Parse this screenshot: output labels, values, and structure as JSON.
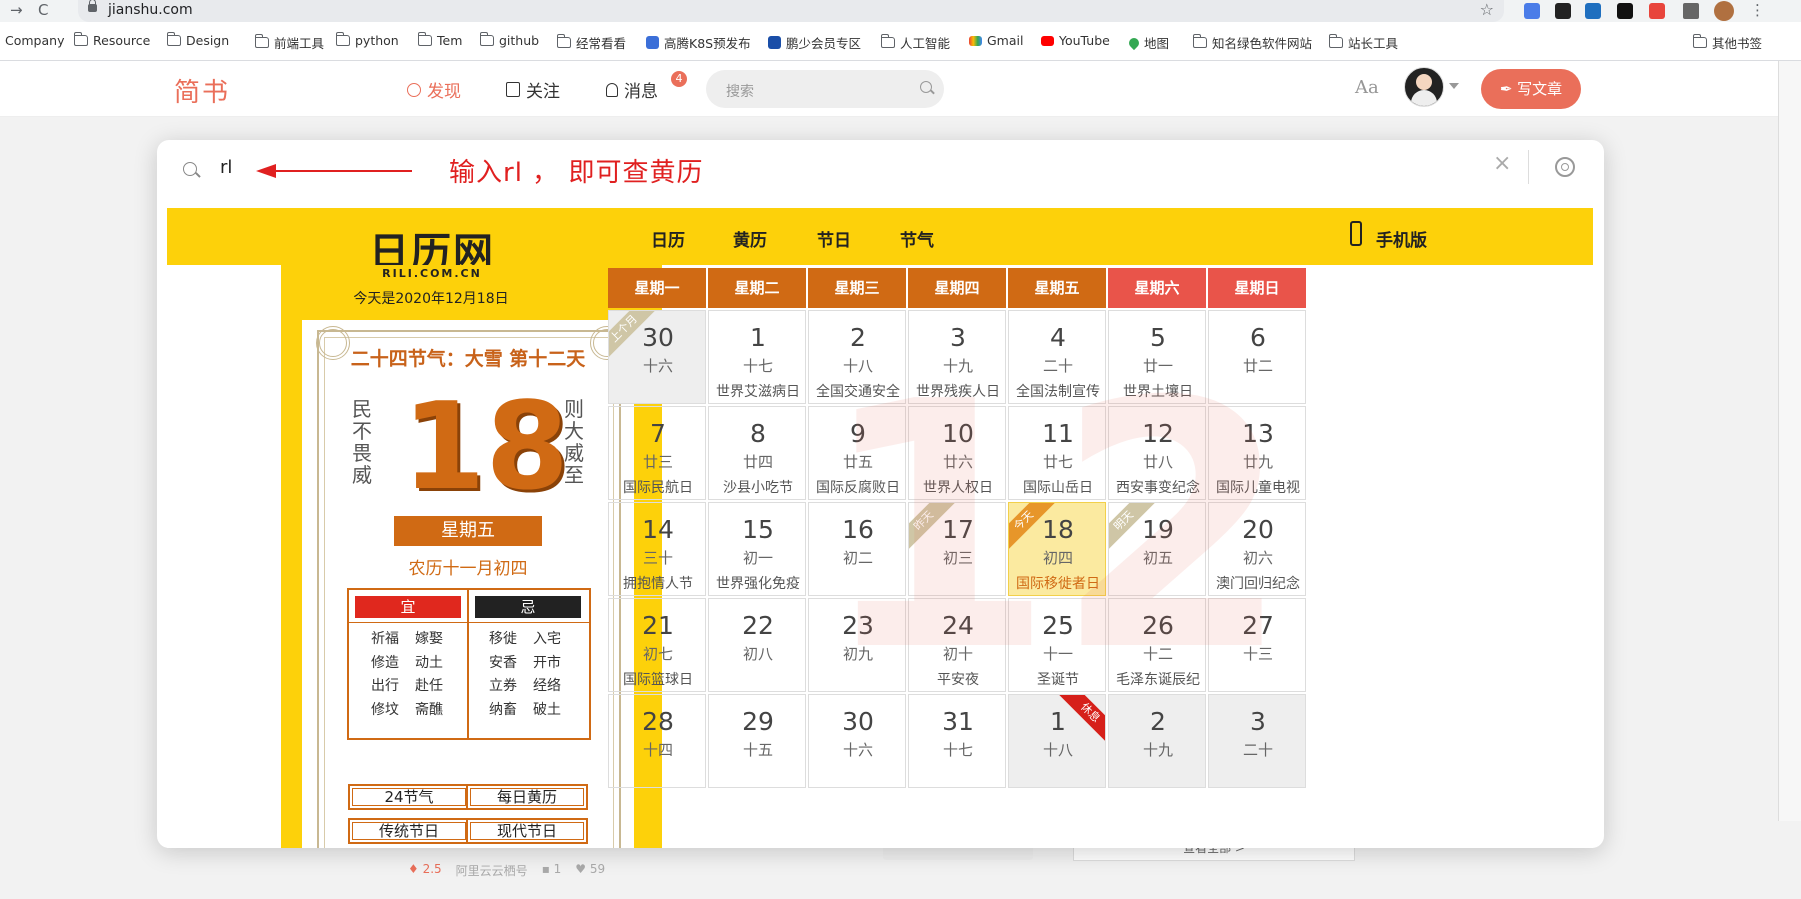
{
  "browser": {
    "url": "jianshu.com",
    "nav_back": "→",
    "nav_reload": "C",
    "star": "☆",
    "menu": "⋮",
    "bookmarks": [
      "Company",
      "Resource",
      "Design",
      "前端工具",
      "python",
      "Tem",
      "github",
      "经常看看",
      "高腾K8S预发布",
      "鹏少会员专区",
      "人工智能",
      "Gmail",
      "YouTube",
      "地图",
      "知名绿色软件网站",
      "站长工具"
    ],
    "other_bookmarks": "其他书签"
  },
  "jianshu": {
    "logo": "简书",
    "nav": [
      "发现",
      "关注",
      "消息"
    ],
    "message_badge": "4",
    "search_placeholder": "搜索",
    "font_btn": "Aa",
    "write_btn": "写文章",
    "under_btn": "查看全部 >",
    "meta": {
      "hot": "2.5",
      "source": "阿里云云栖号",
      "comments": "1",
      "likes": "59"
    }
  },
  "launcher": {
    "query": "rl",
    "annotation": "输入rl ， 即可查黄历",
    "clear": "×"
  },
  "rili": {
    "logo": "日历网",
    "logo_sub": "RILI.COM.CN",
    "today": "今天是2020年12月18日",
    "nav": [
      "日历",
      "黄历",
      "节日",
      "节气"
    ],
    "mobile": "手机版",
    "card": {
      "solar_term": "二十四节气：大雪 第十二天",
      "left_vertical": "民不畏威",
      "right_vertical": "则大威至",
      "day": "18",
      "weekday": "星期五",
      "lunar": "农历十一月初四",
      "yi_label": "宜",
      "ji_label": "忌",
      "yi": [
        "祈福",
        "嫁娶",
        "修造",
        "动土",
        "出行",
        "赴任",
        "修坟",
        "斋醮"
      ],
      "ji": [
        "移徙",
        "入宅",
        "安香",
        "开市",
        "立券",
        "经络",
        "纳畜",
        "破土"
      ],
      "buttons": [
        "24节气",
        "每日黄历",
        "传统节日",
        "现代节日"
      ]
    },
    "calendar": {
      "watermark": "12",
      "weekday_headers": [
        "星期一",
        "星期二",
        "星期三",
        "星期四",
        "星期五",
        "星期六",
        "星期日"
      ],
      "weeks": [
        [
          {
            "d": "30",
            "l": "十六",
            "h": "",
            "tag": "上个月",
            "other": true
          },
          {
            "d": "1",
            "l": "十七",
            "h": "世界艾滋病日"
          },
          {
            "d": "2",
            "l": "十八",
            "h": "全国交通安全"
          },
          {
            "d": "3",
            "l": "十九",
            "h": "世界残疾人日"
          },
          {
            "d": "4",
            "l": "二十",
            "h": "全国法制宣传"
          },
          {
            "d": "5",
            "l": "廿一",
            "h": "世界土壤日"
          },
          {
            "d": "6",
            "l": "廿二",
            "h": ""
          }
        ],
        [
          {
            "d": "7",
            "l": "廿三",
            "h": "国际民航日"
          },
          {
            "d": "8",
            "l": "廿四",
            "h": "沙县小吃节"
          },
          {
            "d": "9",
            "l": "廿五",
            "h": "国际反腐败日"
          },
          {
            "d": "10",
            "l": "廿六",
            "h": "世界人权日"
          },
          {
            "d": "11",
            "l": "廿七",
            "h": "国际山岳日"
          },
          {
            "d": "12",
            "l": "廿八",
            "h": "西安事变纪念"
          },
          {
            "d": "13",
            "l": "廿九",
            "h": "国际儿童电视"
          }
        ],
        [
          {
            "d": "14",
            "l": "三十",
            "h": "拥抱情人节"
          },
          {
            "d": "15",
            "l": "初一",
            "h": "世界强化免疫"
          },
          {
            "d": "16",
            "l": "初二",
            "h": ""
          },
          {
            "d": "17",
            "l": "初三",
            "h": "",
            "tag": "昨天"
          },
          {
            "d": "18",
            "l": "初四",
            "h": "国际移徙者日",
            "tag": "今天",
            "today": true
          },
          {
            "d": "19",
            "l": "初五",
            "h": "",
            "tag": "明天"
          },
          {
            "d": "20",
            "l": "初六",
            "h": "澳门回归纪念"
          }
        ],
        [
          {
            "d": "21",
            "l": "初七",
            "h": "国际篮球日"
          },
          {
            "d": "22",
            "l": "初八",
            "h": ""
          },
          {
            "d": "23",
            "l": "初九",
            "h": ""
          },
          {
            "d": "24",
            "l": "初十",
            "h": "平安夜"
          },
          {
            "d": "25",
            "l": "十一",
            "h": "圣诞节"
          },
          {
            "d": "26",
            "l": "十二",
            "h": "毛泽东诞辰纪"
          },
          {
            "d": "27",
            "l": "十三",
            "h": ""
          }
        ],
        [
          {
            "d": "28",
            "l": "十四",
            "h": ""
          },
          {
            "d": "29",
            "l": "十五",
            "h": ""
          },
          {
            "d": "30",
            "l": "十六",
            "h": ""
          },
          {
            "d": "31",
            "l": "十七",
            "h": ""
          },
          {
            "d": "1",
            "l": "十八",
            "h": "",
            "tag": "休息",
            "other": true,
            "rest": true
          },
          {
            "d": "2",
            "l": "十九",
            "h": "",
            "other": true
          },
          {
            "d": "3",
            "l": "二十",
            "h": "",
            "other": true
          }
        ]
      ]
    }
  },
  "colors": {
    "jianshu_accent": "#ea6f5a",
    "rili_yellow": "#fdd10a",
    "rili_orange": "#d06a14",
    "weekend_header": "#e9544a",
    "annotation_red": "#e02020"
  }
}
